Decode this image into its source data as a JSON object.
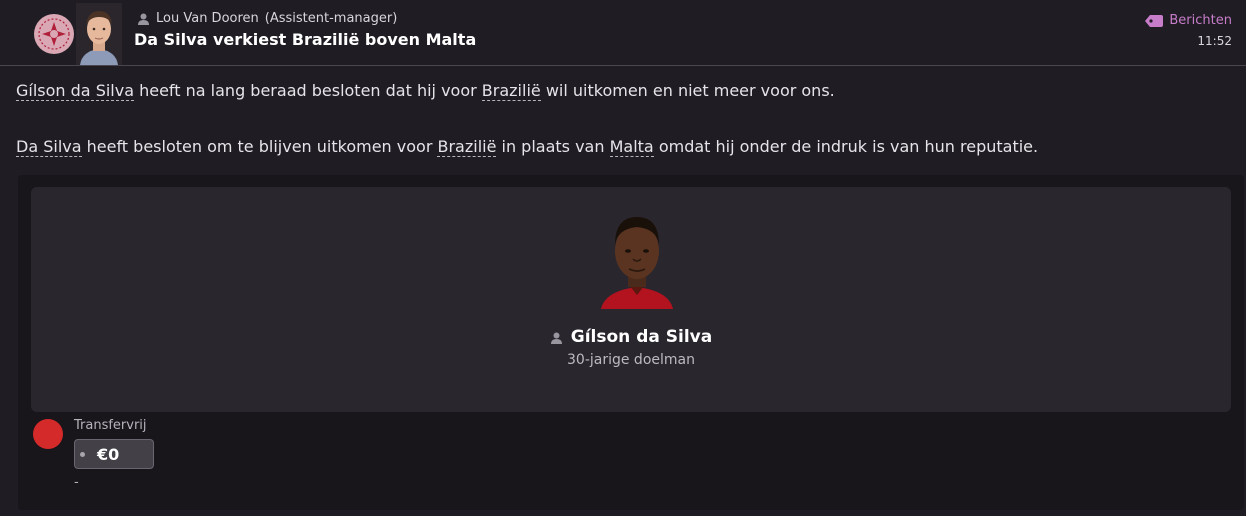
{
  "header": {
    "sender_name": "Lou Van Dooren",
    "sender_role": "(Assistent-manager)",
    "subject": "Da Silva verkiest Brazilië boven Malta",
    "inbox_label": "Berichten",
    "time": "11:52"
  },
  "body": {
    "p1": {
      "link1": "Gílson da Silva",
      "t1": " heeft na lang beraad besloten dat hij voor ",
      "link2": "Brazilië",
      "t2": " wil uitkomen en niet meer voor ons."
    },
    "p2": {
      "link1": "Da Silva",
      "t1": " heeft besloten om te blijven uitkomen voor ",
      "link2": "Brazilië",
      "t2": " in plaats van ",
      "link3": "Malta",
      "t3": " omdat hij onder de indruk is van hun reputatie."
    }
  },
  "player": {
    "name": "Gílson da Silva",
    "description": "30-jarige doelman"
  },
  "transfer": {
    "label": "Transfervrij",
    "value": "€0",
    "footnote": "-"
  },
  "colors": {
    "background": "#1f1c23",
    "accent": "#c77dc9",
    "status_dot": "#d42a2a"
  }
}
